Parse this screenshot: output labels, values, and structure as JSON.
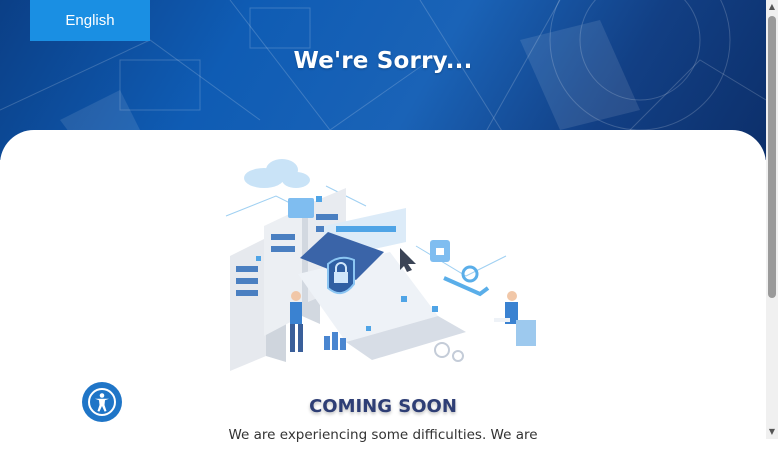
{
  "language_button": {
    "label": "English"
  },
  "hero": {
    "title": "We're Sorry..."
  },
  "content": {
    "heading": "COMING SOON",
    "message": "We are experiencing some difficulties. We are"
  },
  "icons": {
    "accessibility": "accessibility-icon",
    "scroll_up": "scroll-up-arrow",
    "scroll_down": "scroll-down-arrow"
  },
  "colors": {
    "hero_blue": "#1a63b7",
    "language_button": "#1a8fe3",
    "heading": "#2e3e75",
    "accessibility": "#1f75c7"
  }
}
